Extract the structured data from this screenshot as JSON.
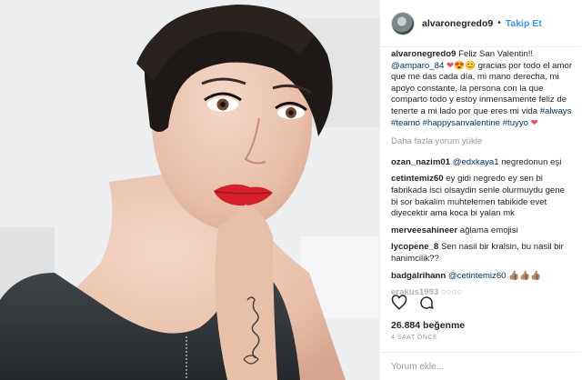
{
  "post": {
    "username": "alvaronegredo9",
    "dot": "•",
    "follow_label": "Takip Et"
  },
  "caption": {
    "user": "alvaronegredo9",
    "text_1": "Feliz San Valentin!!",
    "mention": "@amparo_84",
    "text_2": "gracias por todo el amor que me das cada día, mi mano derecha, mi apoyo constante, la persona con la que comparto todo y estoy inmensamente feliz de tenerte a mi lado por que eres mi vida",
    "tag_1": "#always",
    "tag_2": "#teamo",
    "tag_3": "#happysanvalentine",
    "tag_4": "#tuyyo"
  },
  "load_more": "Daha fazla yorum yükle",
  "comments": [
    {
      "user": "ozan_nazim01",
      "mention": "@edxkaya1",
      "text": "negredonun eşi"
    },
    {
      "user": "cetintemiz60",
      "mention": "",
      "text": "ey gidi negredo ey sen bi fabrikada isci olsaydin senle olurmuydu gene bi sor bakalim muhtelemen tabikide evet diyecektir ama koca bi yalan mk"
    },
    {
      "user": "merveesahineer",
      "mention": "",
      "text": "ağlama emojisi"
    },
    {
      "user": "lycopene_8",
      "mention": "",
      "text": "Sen nasil bir kralsin, bu nasil bir hanimcilik??"
    },
    {
      "user": "badgalrihann",
      "mention": "@cetintemiz60",
      "text": "👍🏽👍🏽👍🏽"
    },
    {
      "user": "erakus1993",
      "mention": "",
      "text": "○○○○"
    }
  ],
  "likes": "26.884 beğenme",
  "time": "4 SAAT ÖNCE",
  "add_comment_placeholder": "Yorum ekle...",
  "icons": {
    "like": "heart-outline-icon",
    "comment": "comment-bubble-icon",
    "caption_heart": "red-heart-emoji",
    "avatar": "profile-avatar"
  },
  "colors": {
    "follow": "#3897f0",
    "link": "#003569",
    "heart": "#ed4956",
    "muted": "#999999"
  }
}
